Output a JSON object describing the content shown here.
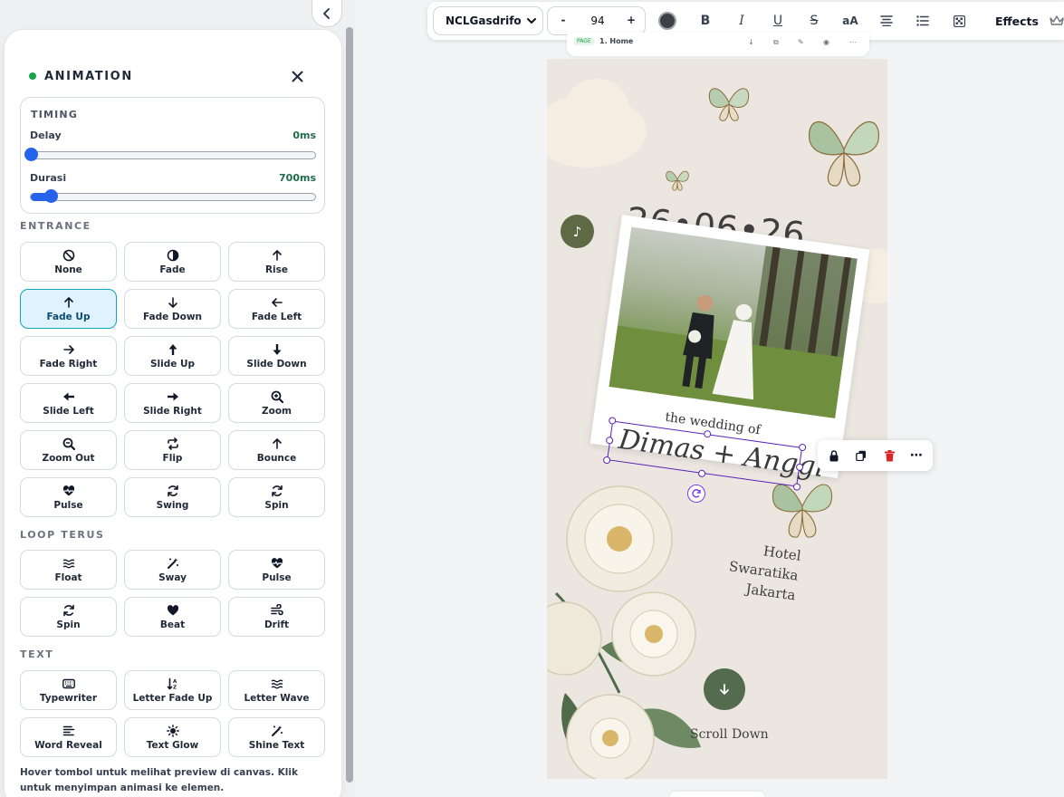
{
  "panel": {
    "title": "ANIMATION",
    "timing": {
      "title": "TIMING",
      "delay_label": "Delay",
      "delay_value": "0ms",
      "delay_fraction": 0.0,
      "duration_label": "Durasi",
      "duration_value": "700ms",
      "duration_fraction": 0.07
    },
    "entrance": {
      "label": "ENTRANCE",
      "items": [
        {
          "label": "None",
          "icon": "ban-icon"
        },
        {
          "label": "Fade",
          "icon": "half-circle-icon"
        },
        {
          "label": "Rise",
          "icon": "arrow-up-icon"
        },
        {
          "label": "Fade Up",
          "icon": "arrow-up-icon",
          "active": true
        },
        {
          "label": "Fade Down",
          "icon": "arrow-down-icon"
        },
        {
          "label": "Fade Left",
          "icon": "arrow-left-icon"
        },
        {
          "label": "Fade Right",
          "icon": "arrow-right-icon"
        },
        {
          "label": "Slide Up",
          "icon": "bold-arrow-up-icon"
        },
        {
          "label": "Slide Down",
          "icon": "bold-arrow-down-icon"
        },
        {
          "label": "Slide Left",
          "icon": "bold-arrow-left-icon"
        },
        {
          "label": "Slide Right",
          "icon": "bold-arrow-right-icon"
        },
        {
          "label": "Zoom",
          "icon": "zoom-in-icon"
        },
        {
          "label": "Zoom Out",
          "icon": "zoom-out-icon"
        },
        {
          "label": "Flip",
          "icon": "repeat-icon"
        },
        {
          "label": "Bounce",
          "icon": "arrow-up-icon"
        },
        {
          "label": "Pulse",
          "icon": "heart-pulse-icon"
        },
        {
          "label": "Swing",
          "icon": "refresh-icon"
        },
        {
          "label": "Spin",
          "icon": "refresh-icon"
        }
      ]
    },
    "loop": {
      "label": "LOOP TERUS",
      "items": [
        {
          "label": "Float",
          "icon": "waves-icon"
        },
        {
          "label": "Sway",
          "icon": "magic-wand-icon"
        },
        {
          "label": "Pulse",
          "icon": "heart-pulse-icon"
        },
        {
          "label": "Spin",
          "icon": "refresh-icon"
        },
        {
          "label": "Beat",
          "icon": "heart-icon"
        },
        {
          "label": "Drift",
          "icon": "wind-icon"
        }
      ]
    },
    "text": {
      "label": "TEXT",
      "items": [
        {
          "label": "Typewriter",
          "icon": "keyboard-icon"
        },
        {
          "label": "Letter Fade Up",
          "icon": "sort-az-icon"
        },
        {
          "label": "Letter Wave",
          "icon": "waves-icon"
        },
        {
          "label": "Word Reveal",
          "icon": "align-left-icon"
        },
        {
          "label": "Text Glow",
          "icon": "sun-icon"
        },
        {
          "label": "Shine Text",
          "icon": "magic-wand-icon"
        }
      ]
    },
    "hint": "Hover tombol untuk melihat preview di canvas. Klik untuk menyimpan animasi ke elemen."
  },
  "toolbar": {
    "font": "NCLGasdrifo",
    "size_minus": "-",
    "size": "94",
    "size_plus": "+",
    "color": "#3f3f46",
    "bold": "B",
    "italic": "I",
    "underline": "U",
    "strike": "S",
    "case": "aA",
    "effects": "Effects"
  },
  "page_tab": {
    "tag": "PAGE",
    "name": "1. Home"
  },
  "canvas": {
    "date": "26•06•26",
    "wedding_of": "the wedding of",
    "names": "Dimas + Anggi",
    "venue_line1": "Hotel Swaratika",
    "venue_line2": "Jakarta",
    "scroll_label": "Scroll Down",
    "music_icon": "♪"
  },
  "colors": {
    "accent": "#2563eb",
    "active_bg": "#e0f2fe",
    "active_border": "#0ea5c4",
    "selection": "#5b21b6",
    "delete": "#dc2626"
  }
}
